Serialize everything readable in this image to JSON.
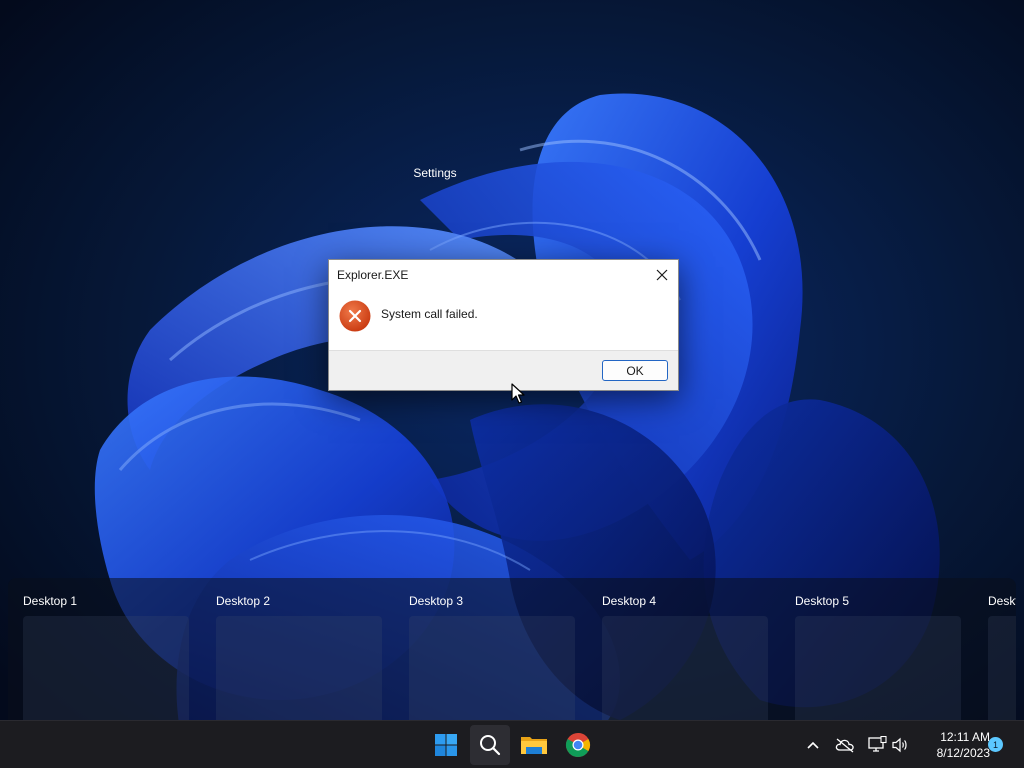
{
  "floating_window_label": "Settings",
  "dialog": {
    "title": "Explorer.EXE",
    "message": "System call failed.",
    "ok_label": "OK",
    "icon": "error-icon",
    "close_icon": "close-icon"
  },
  "task_view": {
    "desktops": [
      {
        "label": "Desktop 1"
      },
      {
        "label": "Desktop 2"
      },
      {
        "label": "Desktop 3"
      },
      {
        "label": "Desktop 4"
      },
      {
        "label": "Desktop 5"
      },
      {
        "label": "Deskt"
      }
    ]
  },
  "taskbar": {
    "pinned": [
      {
        "name": "start",
        "icon": "windows-logo-icon"
      },
      {
        "name": "search",
        "icon": "search-icon"
      },
      {
        "name": "file-explorer",
        "icon": "folder-icon"
      },
      {
        "name": "chrome",
        "icon": "chrome-icon"
      }
    ],
    "tray": [
      {
        "name": "show-hidden",
        "icon": "chevron-up-icon"
      },
      {
        "name": "onedrive",
        "icon": "cloud-offline-icon"
      },
      {
        "name": "network",
        "icon": "network-icon"
      },
      {
        "name": "volume",
        "icon": "speaker-icon"
      }
    ],
    "time": "12:11 AM",
    "date": "8/12/2023",
    "notification_count": "1"
  },
  "colors": {
    "accent": "#0067c0",
    "error": "#d9461b",
    "taskbar": "#1c1c20",
    "wallpaper_bloom": "#1f4fe8"
  }
}
